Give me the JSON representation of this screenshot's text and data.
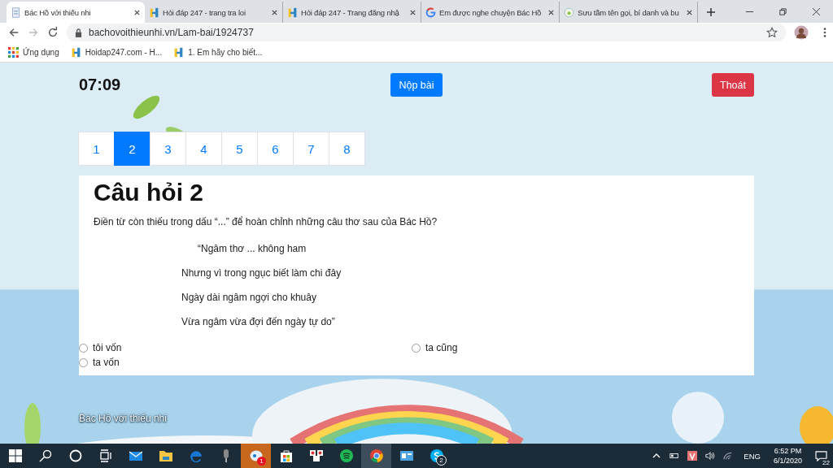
{
  "browser": {
    "tabs": [
      {
        "title": "Bác Hồ với thiếu nhi",
        "selected": true
      },
      {
        "title": "Hỏi đáp 247 - trang tra loi",
        "selected": false
      },
      {
        "title": "Hỏi đáp 247 - Trang đăng nhậ",
        "selected": false
      },
      {
        "title": "Em được nghe chuyện Bác Hồ",
        "selected": false
      },
      {
        "title": "Sưu tầm tên gọi, bí danh và bu",
        "selected": false
      }
    ],
    "address": "bachovoithieunhi.vn/Lam-bai/1924737",
    "bookmarks": [
      "Ứng dụng",
      "Hoidap247.com - H...",
      "1. Em hãy cho biết..."
    ]
  },
  "page": {
    "timer": "07:09",
    "submit_button": "Nộp bài",
    "exit_button": "Thoát",
    "question_nav": [
      {
        "label": "1",
        "selected": false
      },
      {
        "label": "2",
        "selected": true
      },
      {
        "label": "3",
        "selected": false
      },
      {
        "label": "4",
        "selected": false
      },
      {
        "label": "5",
        "selected": false
      },
      {
        "label": "6",
        "selected": false
      },
      {
        "label": "7",
        "selected": false
      },
      {
        "label": "8",
        "selected": false
      }
    ],
    "question": {
      "title": "Câu hỏi 2",
      "prompt": "Điền từ còn thiếu trong dấu “...” để hoàn chỉnh những câu thơ sau của Bác Hồ?",
      "poem_lines": [
        "“Ngâm thơ ... không ham",
        "Nhưng vì trong ngục biết làm chi đây",
        "Ngày dài ngâm ngợi cho khuây",
        "Vừa ngâm vừa đợi đến ngày tự do”"
      ],
      "options": [
        {
          "label": "tôi vốn",
          "selected": false
        },
        {
          "label": "ta cũng",
          "selected": false
        },
        {
          "label": "ta vốn",
          "selected": false
        }
      ]
    },
    "footer": "Bác Hồ với thiếu nhi"
  },
  "taskbar": {
    "apps": [
      {
        "kind": "start",
        "active": false,
        "attention": false
      },
      {
        "kind": "search",
        "active": false,
        "attention": false
      },
      {
        "kind": "cortana",
        "active": false,
        "attention": false
      },
      {
        "kind": "taskview",
        "active": false,
        "attention": false
      },
      {
        "kind": "mail",
        "active": false,
        "attention": false
      },
      {
        "kind": "folder",
        "active": false,
        "attention": false
      },
      {
        "kind": "edge",
        "active": false,
        "attention": false
      },
      {
        "kind": "mic",
        "active": false,
        "attention": false
      },
      {
        "kind": "chat",
        "active": false,
        "attention": true,
        "badge": "1"
      },
      {
        "kind": "store",
        "active": false,
        "attention": false
      },
      {
        "kind": "cards",
        "active": false,
        "attention": false
      },
      {
        "kind": "music",
        "active": false,
        "attention": false
      },
      {
        "kind": "chrome",
        "active": true,
        "attention": false
      },
      {
        "kind": "window",
        "active": false,
        "attention": false
      },
      {
        "kind": "skype",
        "active": false,
        "attention": false,
        "badge": "2"
      }
    ],
    "language": "ENG",
    "time": "6:52 PM",
    "date": "6/1/2020",
    "notifications": "22"
  }
}
